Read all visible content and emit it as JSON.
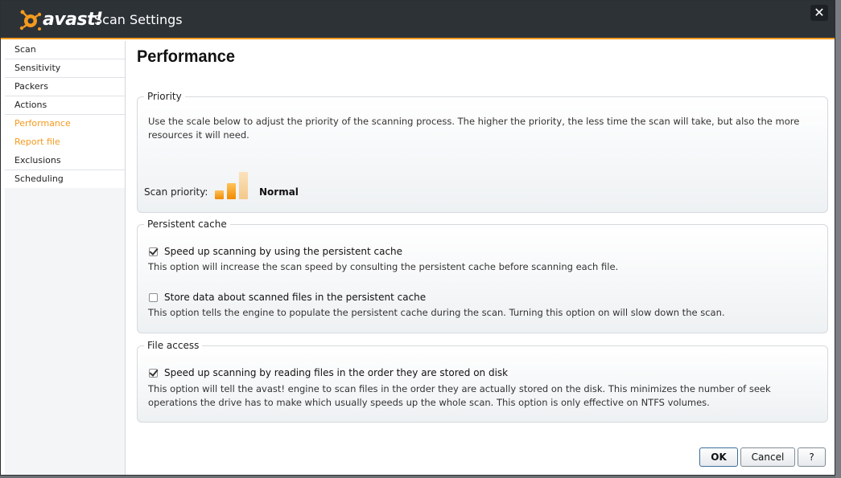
{
  "window": {
    "brand": "avast!",
    "title": "Scan Settings",
    "close_glyph": "✕"
  },
  "sidebar": {
    "items": [
      {
        "label": "Scan"
      },
      {
        "label": "Sensitivity"
      },
      {
        "label": "Packers"
      },
      {
        "label": "Actions"
      },
      {
        "label": "Performance"
      },
      {
        "label": "Report file"
      },
      {
        "label": "Exclusions"
      },
      {
        "label": "Scheduling"
      }
    ]
  },
  "page": {
    "title": "Performance"
  },
  "priority": {
    "title": "Priority",
    "description": "Use the scale below to adjust the priority of the scanning process. The higher the priority, the less time the scan will take, but also the more resources it will need.",
    "scan_priority_label": "Scan priority:",
    "value": "Normal",
    "level": 2,
    "levels": 3
  },
  "persistent_cache": {
    "title": "Persistent cache",
    "option1_label": "Speed up scanning by using the persistent cache",
    "option1_checked": true,
    "option1_desc": "This option will increase the scan speed by consulting the persistent cache before scanning each file.",
    "option2_label": "Store data about scanned files in the persistent cache",
    "option2_checked": false,
    "option2_desc": "This option tells the engine to populate the persistent cache during the scan. Turning this option on will slow down the scan."
  },
  "file_access": {
    "title": "File access",
    "option_label": "Speed up scanning by reading files in the order they are stored on disk",
    "option_checked": true,
    "option_desc": "This option will tell the avast! engine to scan files in the order they are actually stored on the disk. This minimizes the number of seek operations the drive has to make which usually speeds up the whole scan. This option is only effective on NTFS volumes."
  },
  "buttons": {
    "ok": "OK",
    "cancel": "Cancel",
    "help": "?"
  },
  "colors": {
    "accent": "#f39a1e",
    "titlebar": "#2d3237"
  }
}
